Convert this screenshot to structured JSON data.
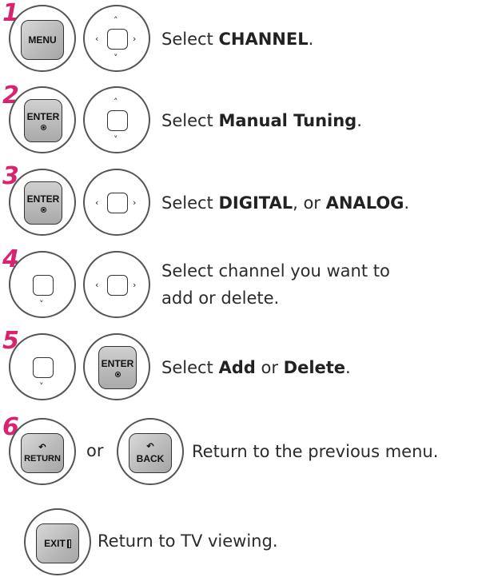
{
  "steps": [
    {
      "number": "1",
      "keys": [
        "MENU",
        "navigation"
      ],
      "text_prefix": "Select  ",
      "text_bold": "CHANNEL",
      "text_suffix": "."
    },
    {
      "number": "2",
      "keys": [
        "ENTER",
        "navigation-up-down"
      ],
      "text_prefix": "Select ",
      "text_bold": "Manual Tuning",
      "text_suffix": "."
    },
    {
      "number": "3",
      "keys": [
        "ENTER",
        "navigation-left-right"
      ],
      "text_prefix": "Select ",
      "text_bold": "DIGITAL",
      "text_mid": ", or ",
      "text_bold2": "ANALOG",
      "text_suffix": "."
    },
    {
      "number": "4",
      "keys": [
        "number-pad",
        "navigation-left-right"
      ],
      "text_line1": "Select channel you want to",
      "text_line2": "add or delete."
    },
    {
      "number": "5",
      "keys": [
        "number-pad",
        "ENTER"
      ],
      "text_prefix": "Select ",
      "text_bold": "Add",
      "text_mid": " or ",
      "text_bold2": "Delete",
      "text_suffix": "."
    },
    {
      "number": "6",
      "keys": [
        "RETURN",
        "BACK"
      ],
      "or_label": "or",
      "text": "Return to the previous menu."
    },
    {
      "keys": [
        "EXIT"
      ],
      "text": "Return to TV viewing."
    }
  ],
  "key_labels": {
    "menu": "MENU",
    "enter": "ENTER",
    "return": "RETURN",
    "back": "BACK",
    "exit": "EXIT",
    "return_symbol": "↶"
  },
  "colors": {
    "step_number": "#d6246e",
    "key_fill": "#b8b8b8",
    "text": "#2b2b2b"
  }
}
